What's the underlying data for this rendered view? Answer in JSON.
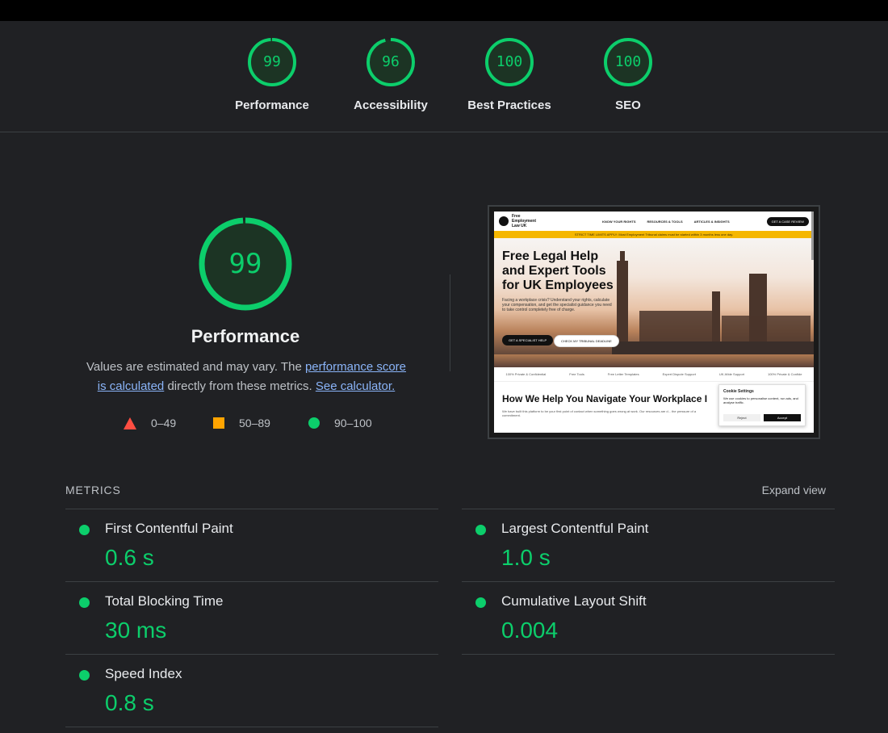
{
  "summary": {
    "gauges": [
      {
        "score": "99",
        "label": "Performance",
        "value": 0.99
      },
      {
        "score": "96",
        "label": "Accessibility",
        "value": 0.96
      },
      {
        "score": "100",
        "label": "Best Practices",
        "value": 1.0
      },
      {
        "score": "100",
        "label": "SEO",
        "value": 1.0
      }
    ]
  },
  "performance": {
    "score": "99",
    "value": 0.99,
    "title": "Performance",
    "desc_prefix": "Values are estimated and may vary. The ",
    "desc_link": "performance score is calculated",
    "desc_mid": " directly from these metrics.",
    "calc_link": "See calculator.",
    "legend": {
      "fail": "0–49",
      "average": "50–89",
      "pass": "90–100"
    }
  },
  "screenshot": {
    "brand": "Free Employment Law UK",
    "nav": [
      "KNOW YOUR RIGHTS",
      "RESOURCES & TOOLS",
      "ARTICLES & INSIGHTS"
    ],
    "cta": "GET A CASE REVIEW",
    "banner": "STRICT TIME LIMITS APPLY: Most Employment Tribunal claims must be started within 3 months less one day.",
    "headline": "Free Legal Help and Expert Tools for UK Employees",
    "paragraph": "Facing a workplace crisis? Understand your rights, calculate your compensation, and get the specialist guidance you need to take control completely free of charge.",
    "btn_primary": "GET A SPECIALIST HELP",
    "btn_secondary": "CHECK MY TRIBUNAL DEADLINE",
    "features": [
      "100% Private & Confidential",
      "Free Tools",
      "Free Letter Templates",
      "Expert Dispute Support",
      "UK-Wide Support",
      "100% Private & Confide"
    ],
    "h2": "How We Help You Navigate Your Workplace I",
    "p2": "We have built this platform to be your first point of contact when something goes wrong at work. Our resources are d... the pressure of a commitment.",
    "cookie_title": "Cookie Settings",
    "cookie_text": "We use cookies to personalise content, run ads, and analyse traffic.",
    "cookie_reject": "Reject",
    "cookie_accept": "Accept"
  },
  "metrics": {
    "heading": "METRICS",
    "expand": "Expand view",
    "items": [
      {
        "label": "First Contentful Paint",
        "value": "0.6 s"
      },
      {
        "label": "Largest Contentful Paint",
        "value": "1.0 s"
      },
      {
        "label": "Total Blocking Time",
        "value": "30 ms"
      },
      {
        "label": "Cumulative Layout Shift",
        "value": "0.004"
      },
      {
        "label": "Speed Index",
        "value": "0.8 s"
      }
    ]
  },
  "colors": {
    "pass": "#0cce6b",
    "average": "#ffa400",
    "fail": "#ff4e42",
    "background": "#202124"
  }
}
